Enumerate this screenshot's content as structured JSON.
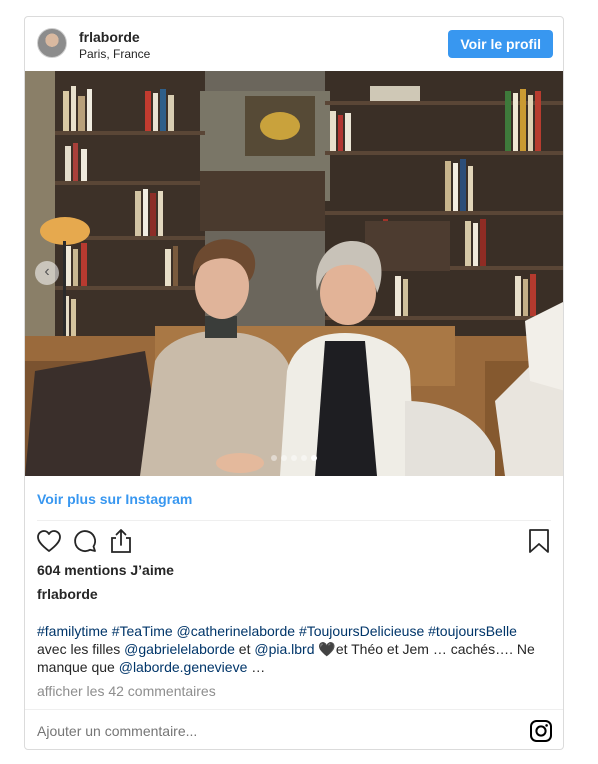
{
  "header": {
    "username": "frlaborde",
    "location": "Paris, France",
    "profile_button": "Voir le profil"
  },
  "carousel": {
    "slide_count": 5,
    "active_slide": 5
  },
  "more_link": "Voir plus sur Instagram",
  "likes_text": "604 mentions J’aime",
  "owner": "frlaborde",
  "caption": {
    "line1": [
      {
        "text": "#familytime",
        "tag": true
      },
      {
        "text": " ",
        "tag": false
      },
      {
        "text": "#TeaTime",
        "tag": true
      },
      {
        "text": " ",
        "tag": false
      },
      {
        "text": "@catherinelaborde",
        "tag": true
      },
      {
        "text": " ",
        "tag": false
      },
      {
        "text": "#ToujoursDelicieuse",
        "tag": true
      },
      {
        "text": " ",
        "tag": false
      },
      {
        "text": "#toujoursBelle",
        "tag": true
      }
    ],
    "line2": [
      {
        "text": "avec les filles ",
        "tag": false
      },
      {
        "text": "@gabrielelaborde",
        "tag": true
      },
      {
        "text": " et ",
        "tag": false
      },
      {
        "text": "@pia.lbrd",
        "tag": true
      },
      {
        "text": " 🖤et Théo et Jem … cachés…. Ne",
        "tag": false
      }
    ],
    "line3": [
      {
        "text": "manque que ",
        "tag": false
      },
      {
        "text": "@laborde.genevieve",
        "tag": true
      },
      {
        "text": " …",
        "tag": false
      }
    ]
  },
  "comments_link": "afficher les 42 commentaires",
  "comment_placeholder": "Ajouter un commentaire...",
  "icons": {
    "like": "heart-icon",
    "comment": "comment-icon",
    "share": "share-icon",
    "save": "bookmark-icon",
    "brand": "instagram-icon",
    "prev": "chevron-left-icon"
  },
  "colors": {
    "accent": "#3897f0",
    "text": "#262626",
    "muted": "#8e8e8e",
    "tag": "#003569"
  }
}
